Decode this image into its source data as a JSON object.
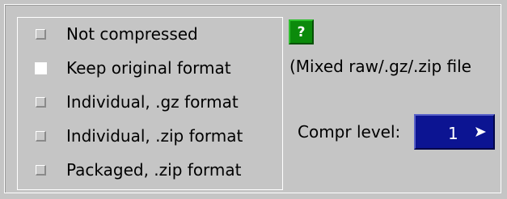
{
  "options": [
    {
      "label": "Not compressed",
      "checked": false
    },
    {
      "label": "Keep original format",
      "checked": true
    },
    {
      "label": "Individual, .gz format",
      "checked": false
    },
    {
      "label": "Individual, .zip format",
      "checked": false
    },
    {
      "label": "Packaged, .zip format",
      "checked": false
    }
  ],
  "help_button": {
    "label": "?"
  },
  "mixed_note": "(Mixed raw/.gz/.zip file",
  "compression": {
    "label": "Compr level:",
    "value": "1",
    "icon": "arrow-right-icon"
  },
  "colors": {
    "background": "#c5c5c5",
    "help_green": "#0b8a0b",
    "field_blue": "#0c1492",
    "checked_white": "#ffffff"
  }
}
